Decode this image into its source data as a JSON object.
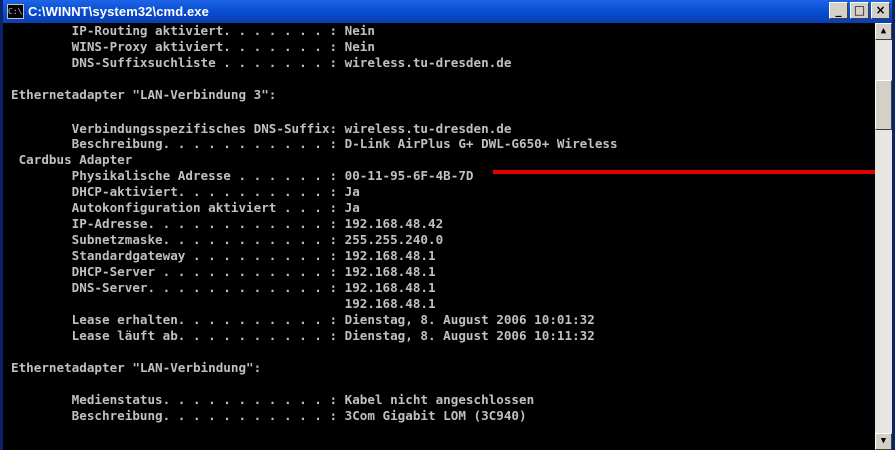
{
  "window": {
    "title": "C:\\WINNT\\system32\\cmd.exe",
    "icon": "cmd-icon",
    "buttons": {
      "minimize": "_",
      "maximize": "□",
      "close": "×"
    }
  },
  "console": {
    "lines": [
      "        IP-Routing aktiviert. . . . . . . : Nein",
      "        WINS-Proxy aktiviert. . . . . . . : Nein",
      "        DNS-Suffixsuchliste . . . . . . . : wireless.tu-dresden.de",
      "",
      "Ethernetadapter \"LAN-Verbindung 3\":",
      "",
      "        Verbindungsspezifisches DNS-Suffix: wireless.tu-dresden.de",
      "        Beschreibung. . . . . . . . . . . : D-Link AirPlus G+ DWL-G650+ Wireless",
      " Cardbus Adapter",
      "        Physikalische Adresse . . . . . . : 00-11-95-6F-4B-7D",
      "        DHCP-aktiviert. . . . . . . . . . : Ja",
      "        Autokonfiguration aktiviert . . . : Ja",
      "        IP-Adresse. . . . . . . . . . . . : 192.168.48.42",
      "        Subnetzmaske. . . . . . . . . . . : 255.255.240.0",
      "        Standardgateway . . . . . . . . . : 192.168.48.1",
      "        DHCP-Server . . . . . . . . . . . : 192.168.48.1",
      "        DNS-Server. . . . . . . . . . . . : 192.168.48.1",
      "                                            192.168.48.1",
      "        Lease erhalten. . . . . . . . . . : Dienstag, 8. August 2006 10:01:32",
      "        Lease läuft ab. . . . . . . . . . : Dienstag, 8. August 2006 10:11:32",
      "",
      "Ethernetadapter \"LAN-Verbindung\":",
      "",
      "        Medienstatus. . . . . . . . . . . : Kabel nicht angeschlossen",
      "        Beschreibung. . . . . . . . . . . : 3Com Gigabit LOM (3C940)"
    ]
  },
  "colors": {
    "titlebar": "#0a52d6",
    "console_bg": "#000000",
    "console_text": "#c0c0c0",
    "highlight_underline": "#e00000"
  }
}
